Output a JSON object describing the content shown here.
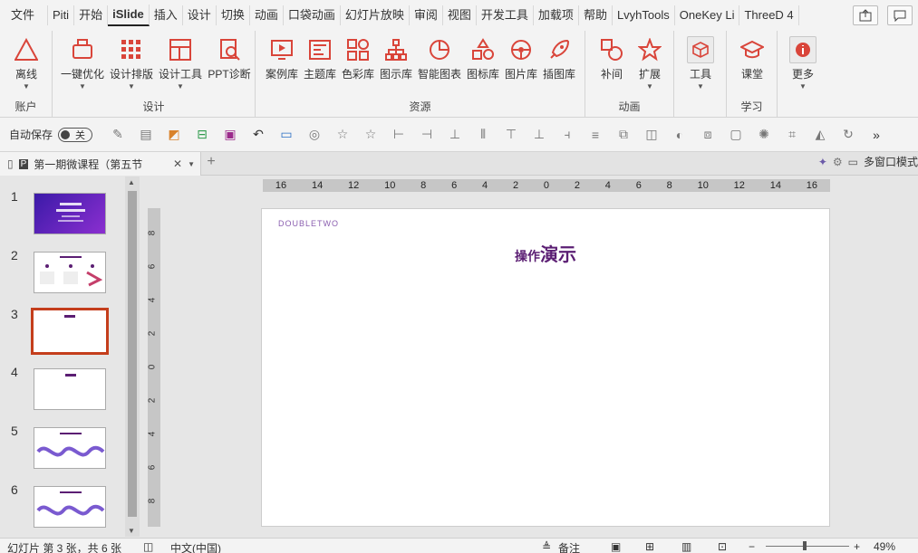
{
  "menu": {
    "tabs": [
      "文件",
      "Piti",
      "开始",
      "iSlide",
      "插入",
      "设计",
      "切换",
      "动画",
      "口袋动画",
      "幻灯片放映",
      "审阅",
      "视图",
      "开发工具",
      "加载项",
      "帮助",
      "LvyhTools",
      "OneKey Li",
      "ThreeD 4"
    ],
    "active": "iSlide"
  },
  "ribbon": {
    "groups": {
      "account": "账户",
      "design": "设计",
      "resources": "资源",
      "animation": "动画",
      "learn": "学习"
    },
    "buttons": {
      "offline": "离线",
      "optimize": "一键优化",
      "layout": "设计排版",
      "design_tools": "设计工具",
      "ppt_diag": "PPT诊断",
      "cases": "案例库",
      "themes": "主题库",
      "colors": "色彩库",
      "diagrams": "图示库",
      "charts": "智能图表",
      "icons": "图标库",
      "images": "图片库",
      "illustrations": "插图库",
      "tween": "补间",
      "extend": "扩展",
      "tools": "工具",
      "classroom": "课堂",
      "more": "更多"
    }
  },
  "qat": {
    "autosave_label": "自动保存",
    "autosave_state": "关"
  },
  "doc_tab": {
    "title": "第一期微课程（第五节",
    "right_label": "多窗口模式"
  },
  "thumbnails": {
    "numbers": [
      "1",
      "2",
      "3",
      "4",
      "5",
      "6"
    ],
    "selected": "3"
  },
  "ruler": {
    "h_ticks": [
      "16",
      "14",
      "12",
      "10",
      "8",
      "6",
      "4",
      "2",
      "0",
      "2",
      "4",
      "6",
      "8",
      "10",
      "12",
      "14",
      "16"
    ],
    "v_ticks": [
      "8",
      "6",
      "4",
      "2",
      "0",
      "2",
      "4",
      "6",
      "8"
    ]
  },
  "slide": {
    "brand": "DOUBLETWO",
    "heading_small": "操作",
    "heading_big": "演示"
  },
  "status": {
    "slide_info": "幻灯片 第 3 张，共 6 张",
    "language": "中文(中国)",
    "notes": "备注",
    "zoom": "49%"
  },
  "colors": {
    "accent_red": "#c43e1c",
    "slide_purple": "#5b1e73"
  }
}
